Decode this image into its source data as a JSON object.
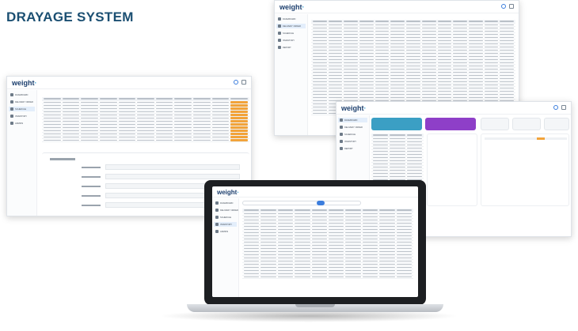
{
  "page": {
    "title": "DRAYAGE SYSTEM"
  },
  "app": {
    "logo_text": "weight"
  },
  "sidebar_items": [
    "DASHBOARD",
    "DELIVERY ORDER",
    "SCHEDULE",
    "INVENTORY",
    "REPORT",
    "ADMINS"
  ],
  "dashboard": {
    "date_field_label": "Date",
    "right_labels": [
      "Status",
      "Return",
      "Invoice"
    ],
    "cards": [
      "Pending",
      "Completed",
      "Invoiced",
      "Total"
    ]
  },
  "colors": {
    "title": "#1b4f72",
    "accent_teal": "#3b9fc4",
    "accent_purple": "#8e3fc8",
    "highlight_orange": "#f2a33a",
    "link_blue": "#3b7ddd"
  },
  "icons": [
    "home-icon",
    "document-icon",
    "calendar-icon",
    "box-icon",
    "chart-icon",
    "user-icon",
    "settings-icon",
    "logout-icon"
  ]
}
